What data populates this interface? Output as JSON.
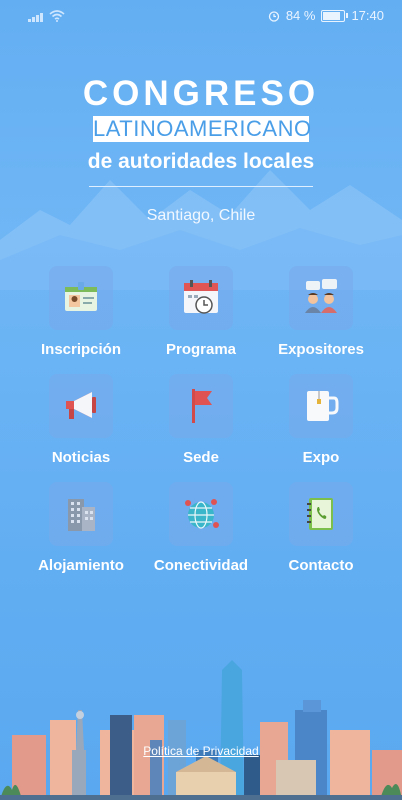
{
  "status_bar": {
    "battery": "84 %",
    "time": "17:40",
    "battery_level": 0.84
  },
  "header": {
    "title_line1": "CONGRESO",
    "title_line2": "LATINOAMERICANO",
    "title_line3": "de autoridades locales",
    "city": "Santiago, Chile"
  },
  "menu": {
    "items": [
      {
        "label": "Inscripción",
        "icon": "id-card-icon"
      },
      {
        "label": "Programa",
        "icon": "calendar-clock-icon"
      },
      {
        "label": "Expositores",
        "icon": "speakers-icon"
      },
      {
        "label": "Noticias",
        "icon": "megaphone-icon"
      },
      {
        "label": "Sede",
        "icon": "flag-icon"
      },
      {
        "label": "Expo",
        "icon": "mug-icon"
      },
      {
        "label": "Alojamiento",
        "icon": "building-icon"
      },
      {
        "label": "Conectividad",
        "icon": "globe-network-icon"
      },
      {
        "label": "Contacto",
        "icon": "address-book-icon"
      }
    ]
  },
  "footer": {
    "privacy_label": "Política de Privacidad"
  }
}
